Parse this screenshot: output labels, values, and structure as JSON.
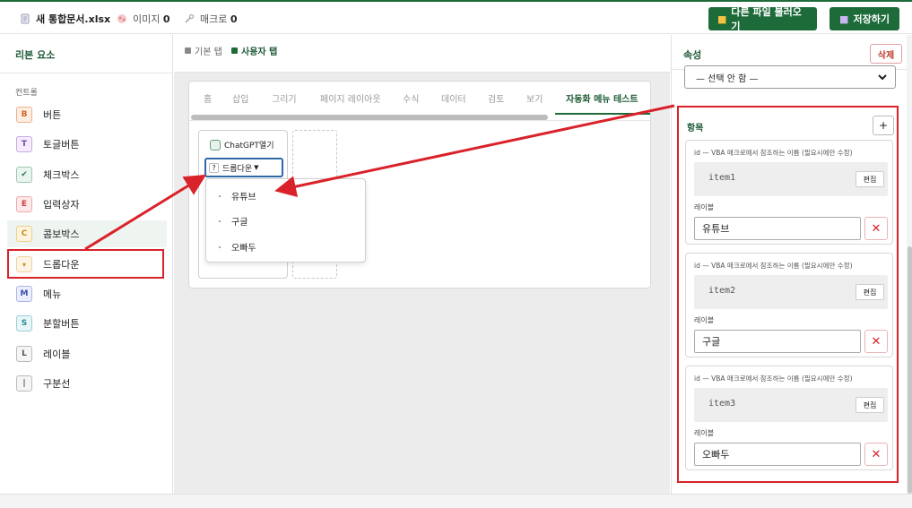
{
  "topbar": {
    "file_name": "새 통합문서.xlsx",
    "images_label": "이미지",
    "images_count": "0",
    "macros_label": "매크로",
    "macros_count": "0",
    "load_button": "다른 파일 불러오기",
    "save_button": "저장하기",
    "accent_color": "#1e6b3a"
  },
  "left_panel": {
    "title": "리본 요소",
    "section": "컨트롤",
    "controls": [
      {
        "badge": "B",
        "label": "버튼"
      },
      {
        "badge": "T",
        "label": "토글버튼"
      },
      {
        "badge": "✔",
        "label": "체크박스"
      },
      {
        "badge": "E",
        "label": "입력상자"
      },
      {
        "badge": "C",
        "label": "콤보박스"
      },
      {
        "badge": "▾",
        "label": "드롭다운"
      },
      {
        "badge": "M",
        "label": "메뉴"
      },
      {
        "badge": "S",
        "label": "분할버튼"
      },
      {
        "badge": "L",
        "label": "레이블"
      },
      {
        "badge": "|",
        "label": "구분선"
      }
    ]
  },
  "middle": {
    "tab_basic": "기본 탭",
    "tab_user": "사용자 탭",
    "ribbon_tabs": [
      "홈",
      "삽입",
      "그리기",
      "페이지 레이아웃",
      "수식",
      "데이터",
      "검토",
      "보기",
      "자동화 메뉴 테스트"
    ],
    "group_button_label": "ChatGPT열기",
    "dropdown_label": "드롭다운",
    "dropdown_items": [
      "유튜브",
      "구글",
      "오빠두"
    ]
  },
  "right_panel": {
    "title": "속성",
    "delete_button": "삭제",
    "select_value": "— 선택 안 함 —",
    "items_title": "항목",
    "add_button": "+",
    "id_hint": "id — VBA 매크로에서 참조하는 이름 (필요시에만 수정)",
    "edit_button": "편집",
    "label_caption": "레이블",
    "items": [
      {
        "id": "item1",
        "label": "유튜브"
      },
      {
        "id": "item2",
        "label": "구글"
      },
      {
        "id": "item3",
        "label": "오빠두"
      }
    ]
  }
}
